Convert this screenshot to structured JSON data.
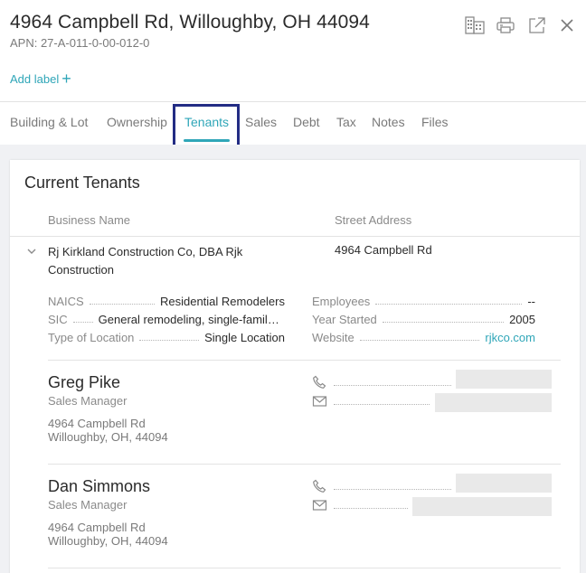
{
  "header": {
    "address": "4964 Campbell Rd, Willoughby, OH 44094",
    "apn": "APN: 27-A-011-0-00-012-0",
    "add_label": "Add label",
    "icons": [
      "building-grid-icon",
      "printer-icon",
      "external-link-icon",
      "close-icon"
    ]
  },
  "tabs": [
    {
      "label": "Building & Lot"
    },
    {
      "label": "Ownership"
    },
    {
      "label": "Tenants",
      "active": true
    },
    {
      "label": "Sales"
    },
    {
      "label": "Debt"
    },
    {
      "label": "Tax"
    },
    {
      "label": "Notes"
    },
    {
      "label": "Files"
    }
  ],
  "tenants": {
    "title": "Current Tenants",
    "columns": {
      "business": "Business Name",
      "street": "Street Address"
    },
    "tenant": {
      "business_name": "Rj Kirkland Construction Co, DBA Rjk Construction",
      "street_address": "4964 Campbell Rd",
      "details_left": [
        {
          "label": "NAICS",
          "value": "Residential Remodelers"
        },
        {
          "label": "SIC",
          "value": "General remodeling, single-family houses"
        },
        {
          "label": "Type of Location",
          "value": "Single Location"
        }
      ],
      "details_right": [
        {
          "label": "Employees",
          "value": "--"
        },
        {
          "label": "Year Started",
          "value": "2005"
        },
        {
          "label": "Website",
          "value": "rjkco.com"
        }
      ]
    },
    "contacts": [
      {
        "name": "Greg Pike",
        "role": "Sales Manager",
        "address_line1": "4964 Campbell Rd",
        "address_line2": "Willoughby, OH, 44094"
      },
      {
        "name": "Dan Simmons",
        "role": "Sales Manager",
        "address_line1": "4964 Campbell Rd",
        "address_line2": "Willoughby, OH, 44094"
      }
    ]
  },
  "colors": {
    "accent": "#2fa6b8",
    "highlight_box": "#232c84",
    "content_background": "#f0f1f4"
  }
}
